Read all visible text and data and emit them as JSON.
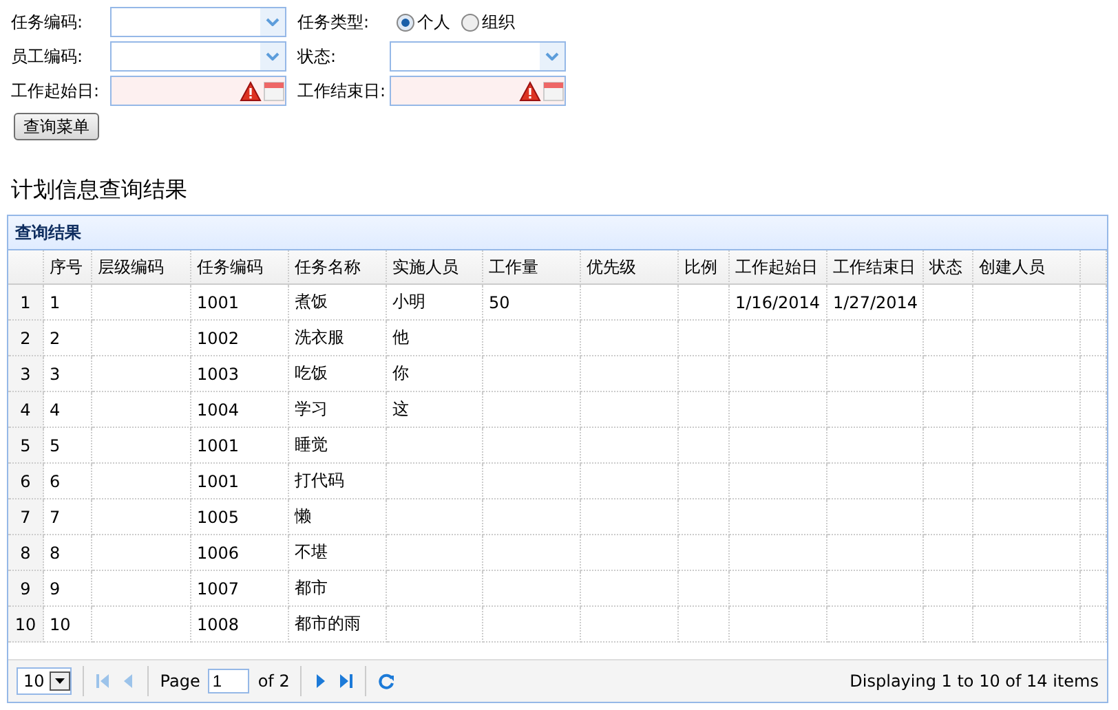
{
  "form": {
    "rows": [
      {
        "fields": [
          {
            "label": "任务编码:",
            "kind": "combo"
          },
          {
            "label": "任务类型:",
            "kind": "radio",
            "options": [
              {
                "label": "个人",
                "selected": true
              },
              {
                "label": "组织",
                "selected": false
              }
            ]
          }
        ]
      },
      {
        "fields": [
          {
            "label": "员工编码:",
            "kind": "combo"
          },
          {
            "label": "状态:",
            "kind": "combo"
          }
        ]
      },
      {
        "fields": [
          {
            "label": "工作起始日:",
            "kind": "date"
          },
          {
            "label": "工作结束日:",
            "kind": "date"
          }
        ]
      }
    ],
    "button": "查询菜单"
  },
  "heading": "计划信息查询结果",
  "panel": {
    "title": "查询结果",
    "columns": [
      {
        "label": "序号"
      },
      {
        "label": "层级编码"
      },
      {
        "label": "任务编码"
      },
      {
        "label": "任务名称"
      },
      {
        "label": "实施人员"
      },
      {
        "label": "工作量"
      },
      {
        "label": "优先级"
      },
      {
        "label": "比例"
      },
      {
        "label": "工作起始日"
      },
      {
        "label": "工作结束日"
      },
      {
        "label": "状态"
      },
      {
        "label": "创建人员"
      }
    ],
    "rows": [
      {
        "num": "1",
        "cells": [
          "1",
          "",
          "1001",
          "煮饭",
          "小明",
          "50",
          "",
          "",
          "1/16/2014",
          "1/27/2014",
          "",
          ""
        ]
      },
      {
        "num": "2",
        "cells": [
          "2",
          "",
          "1002",
          "洗衣服",
          "他",
          "",
          "",
          "",
          "",
          "",
          "",
          ""
        ]
      },
      {
        "num": "3",
        "cells": [
          "3",
          "",
          "1003",
          "吃饭",
          "你",
          "",
          "",
          "",
          "",
          "",
          "",
          ""
        ]
      },
      {
        "num": "4",
        "cells": [
          "4",
          "",
          "1004",
          "学习",
          "这",
          "",
          "",
          "",
          "",
          "",
          "",
          ""
        ]
      },
      {
        "num": "5",
        "cells": [
          "5",
          "",
          "1001",
          "睡觉",
          "",
          "",
          "",
          "",
          "",
          "",
          "",
          ""
        ]
      },
      {
        "num": "6",
        "cells": [
          "6",
          "",
          "1001",
          "打代码",
          "",
          "",
          "",
          "",
          "",
          "",
          "",
          ""
        ]
      },
      {
        "num": "7",
        "cells": [
          "7",
          "",
          "1005",
          "懒",
          "",
          "",
          "",
          "",
          "",
          "",
          "",
          ""
        ]
      },
      {
        "num": "8",
        "cells": [
          "8",
          "",
          "1006",
          "不堪",
          "",
          "",
          "",
          "",
          "",
          "",
          "",
          ""
        ]
      },
      {
        "num": "9",
        "cells": [
          "9",
          "",
          "1007",
          "都市",
          "",
          "",
          "",
          "",
          "",
          "",
          "",
          ""
        ]
      },
      {
        "num": "10",
        "cells": [
          "10",
          "",
          "1008",
          "都市的雨",
          "",
          "",
          "",
          "",
          "",
          "",
          "",
          ""
        ]
      }
    ],
    "pager": {
      "page_size": "10",
      "page_label": "Page",
      "page": "1",
      "of": "of 2",
      "info": "Displaying 1 to 10 of 14 items"
    }
  }
}
